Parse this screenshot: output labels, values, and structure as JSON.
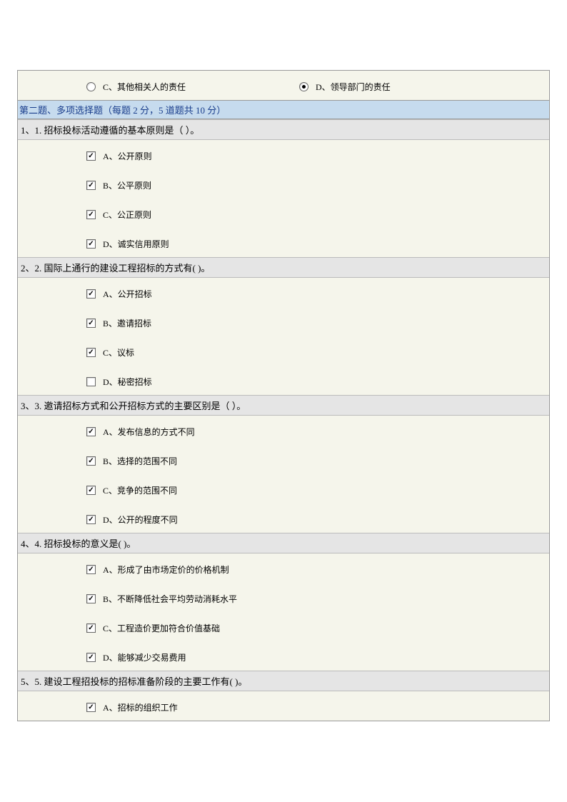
{
  "top_radio": {
    "c": {
      "label": "C、其他相关人的责任",
      "selected": false
    },
    "d": {
      "label": "D、领导部门的责任",
      "selected": true
    }
  },
  "section2": {
    "title": "第二题、多项选择题（每题 2 分，5 道题共 10 分）"
  },
  "questions": [
    {
      "header": "1、1. 招标投标活动遵循的基本原则是（ ）。",
      "options": [
        {
          "label": "A、公开原则",
          "checked": true
        },
        {
          "label": "B、公平原则",
          "checked": true
        },
        {
          "label": "C、公正原则",
          "checked": true
        },
        {
          "label": "D、诚实信用原则",
          "checked": true
        }
      ]
    },
    {
      "header": "2、2. 国际上通行的建设工程招标的方式有( )。",
      "options": [
        {
          "label": "A、公开招标",
          "checked": true
        },
        {
          "label": "B、邀请招标",
          "checked": true
        },
        {
          "label": "C、议标",
          "checked": true
        },
        {
          "label": "D、秘密招标",
          "checked": false
        }
      ]
    },
    {
      "header": "3、3. 邀请招标方式和公开招标方式的主要区别是（ ）。",
      "options": [
        {
          "label": "A、发布信息的方式不同",
          "checked": true
        },
        {
          "label": "B、选择的范围不同",
          "checked": true
        },
        {
          "label": "C、竞争的范围不同",
          "checked": true
        },
        {
          "label": "D、公开的程度不同",
          "checked": true
        }
      ]
    },
    {
      "header": "4、4. 招标投标的意义是( )。",
      "options": [
        {
          "label": "A、形成了由市场定价的价格机制",
          "checked": true
        },
        {
          "label": "B、不断降低社会平均劳动消耗水平",
          "checked": true
        },
        {
          "label": "C、工程造价更加符合价值基础",
          "checked": true
        },
        {
          "label": "D、能够减少交易费用",
          "checked": true
        }
      ]
    },
    {
      "header": "5、5. 建设工程招投标的招标准备阶段的主要工作有( )。",
      "options": [
        {
          "label": "A、招标的组织工作",
          "checked": true
        }
      ]
    }
  ]
}
